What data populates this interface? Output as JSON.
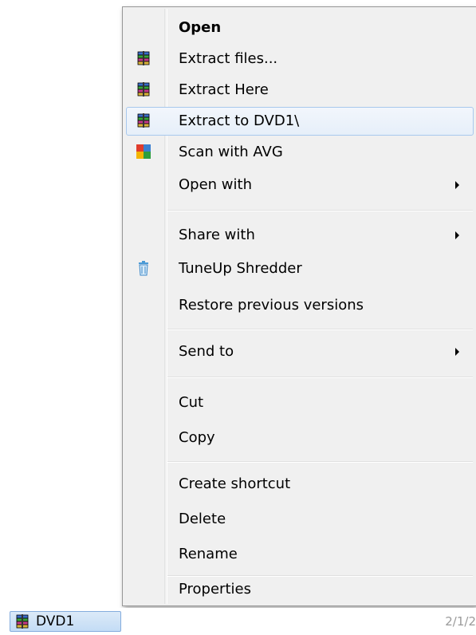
{
  "menu": {
    "items": [
      {
        "label": "Open",
        "icon": "",
        "bold": true
      },
      {
        "label": "Extract files...",
        "icon": "winrar-icon"
      },
      {
        "label": "Extract Here",
        "icon": "winrar-icon"
      },
      {
        "label": "Extract to DVD1\\",
        "icon": "winrar-icon",
        "hovered": true
      },
      {
        "label": "Scan with AVG",
        "icon": "avg-icon"
      },
      {
        "label": "Open with",
        "icon": "",
        "submenu": true
      },
      {
        "label": "Share with",
        "icon": "",
        "submenu": true
      },
      {
        "label": "TuneUp Shredder",
        "icon": "trash-icon"
      },
      {
        "label": "Restore previous versions",
        "icon": ""
      },
      {
        "label": "Send to",
        "icon": "",
        "submenu": true
      },
      {
        "label": "Cut",
        "icon": ""
      },
      {
        "label": "Copy",
        "icon": ""
      },
      {
        "label": "Create shortcut",
        "icon": ""
      },
      {
        "label": "Delete",
        "icon": ""
      },
      {
        "label": "Rename",
        "icon": ""
      },
      {
        "label": "Properties",
        "icon": ""
      }
    ]
  },
  "file": {
    "name": "DVD1",
    "date_fragment": "2/1/2"
  },
  "colors": {
    "menu_background": "#f0f0f0",
    "hover_border": "#a8c8ed",
    "selected_file_background": "#c3dcf5"
  }
}
